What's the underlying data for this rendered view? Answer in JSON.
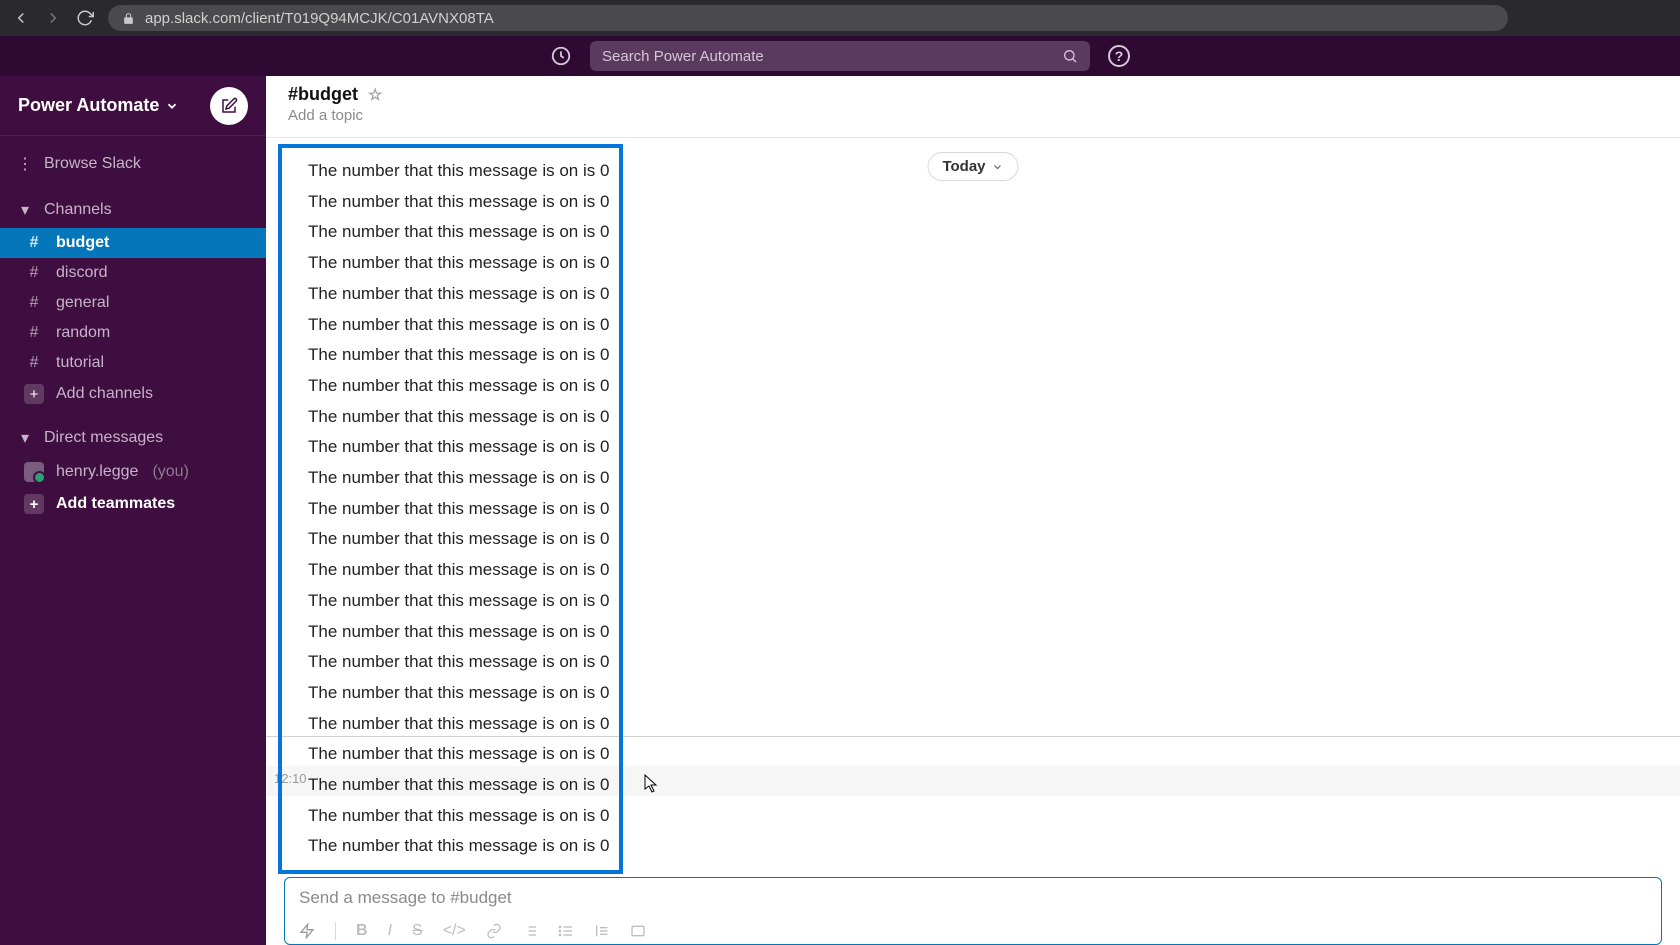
{
  "browser": {
    "url": "app.slack.com/client/T019Q94MCJK/C01AVNX08TA"
  },
  "searchbar": {
    "placeholder": "Search Power Automate"
  },
  "workspace": {
    "name": "Power Automate"
  },
  "sidebar": {
    "browse": "Browse Slack",
    "channels_label": "Channels",
    "channels": [
      {
        "label": "budget",
        "active": true
      },
      {
        "label": "discord",
        "active": false
      },
      {
        "label": "general",
        "active": false
      },
      {
        "label": "random",
        "active": false
      },
      {
        "label": "tutorial",
        "active": false
      }
    ],
    "add_channels": "Add channels",
    "dm_label": "Direct messages",
    "dm_user": "henry.legge",
    "dm_you": "(you)",
    "add_teammates": "Add teammates"
  },
  "channel": {
    "title": "#budget",
    "topic": "Add a topic",
    "date_pill": "Today",
    "hover_time": "12:10",
    "messages": [
      "The number that this message is on is 0",
      "The number that this message is on is 0",
      "The number that this message is on is 0",
      "The number that this message is on is 0",
      "The number that this message is on is 0",
      "The number that this message is on is 0",
      "The number that this message is on is 0",
      "The number that this message is on is 0",
      "The number that this message is on is 0",
      "The number that this message is on is 0",
      "The number that this message is on is 0",
      "The number that this message is on is 0",
      "The number that this message is on is 0",
      "The number that this message is on is 0",
      "The number that this message is on is 0",
      "The number that this message is on is 0",
      "The number that this message is on is 0",
      "The number that this message is on is 0",
      "The number that this message is on is 0",
      "The number that this message is on is 0",
      "The number that this message is on is 0",
      "The number that this message is on is 0",
      "The number that this message is on is 0"
    ],
    "composer_placeholder": "Send a message to #budget"
  }
}
